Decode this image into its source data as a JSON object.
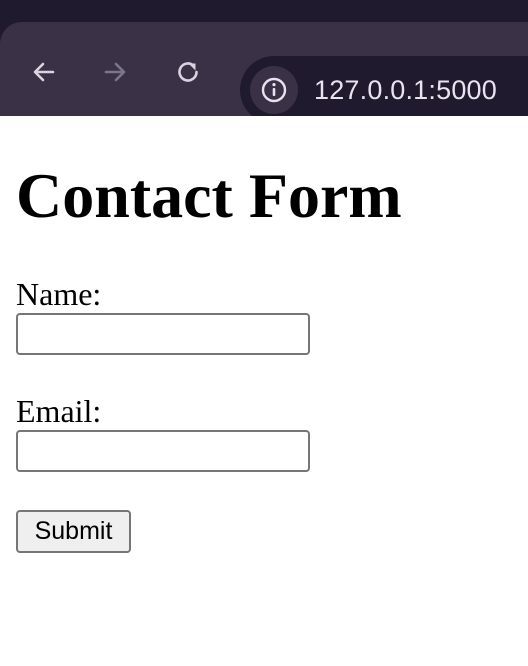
{
  "browser": {
    "url": "127.0.0.1:5000",
    "icons": {
      "back": "back-arrow-icon",
      "forward": "forward-arrow-icon",
      "reload": "reload-icon",
      "site_info": "info-icon"
    },
    "colors": {
      "frame": "#201a2e",
      "toolbar": "#3a3146",
      "text": "#e8e3ee",
      "disabled_icon": "#7d7589"
    }
  },
  "page": {
    "title": "Contact Form",
    "form": {
      "name_label": "Name:",
      "name_value": "",
      "email_label": "Email:",
      "email_value": "",
      "submit_label": "Submit"
    }
  }
}
